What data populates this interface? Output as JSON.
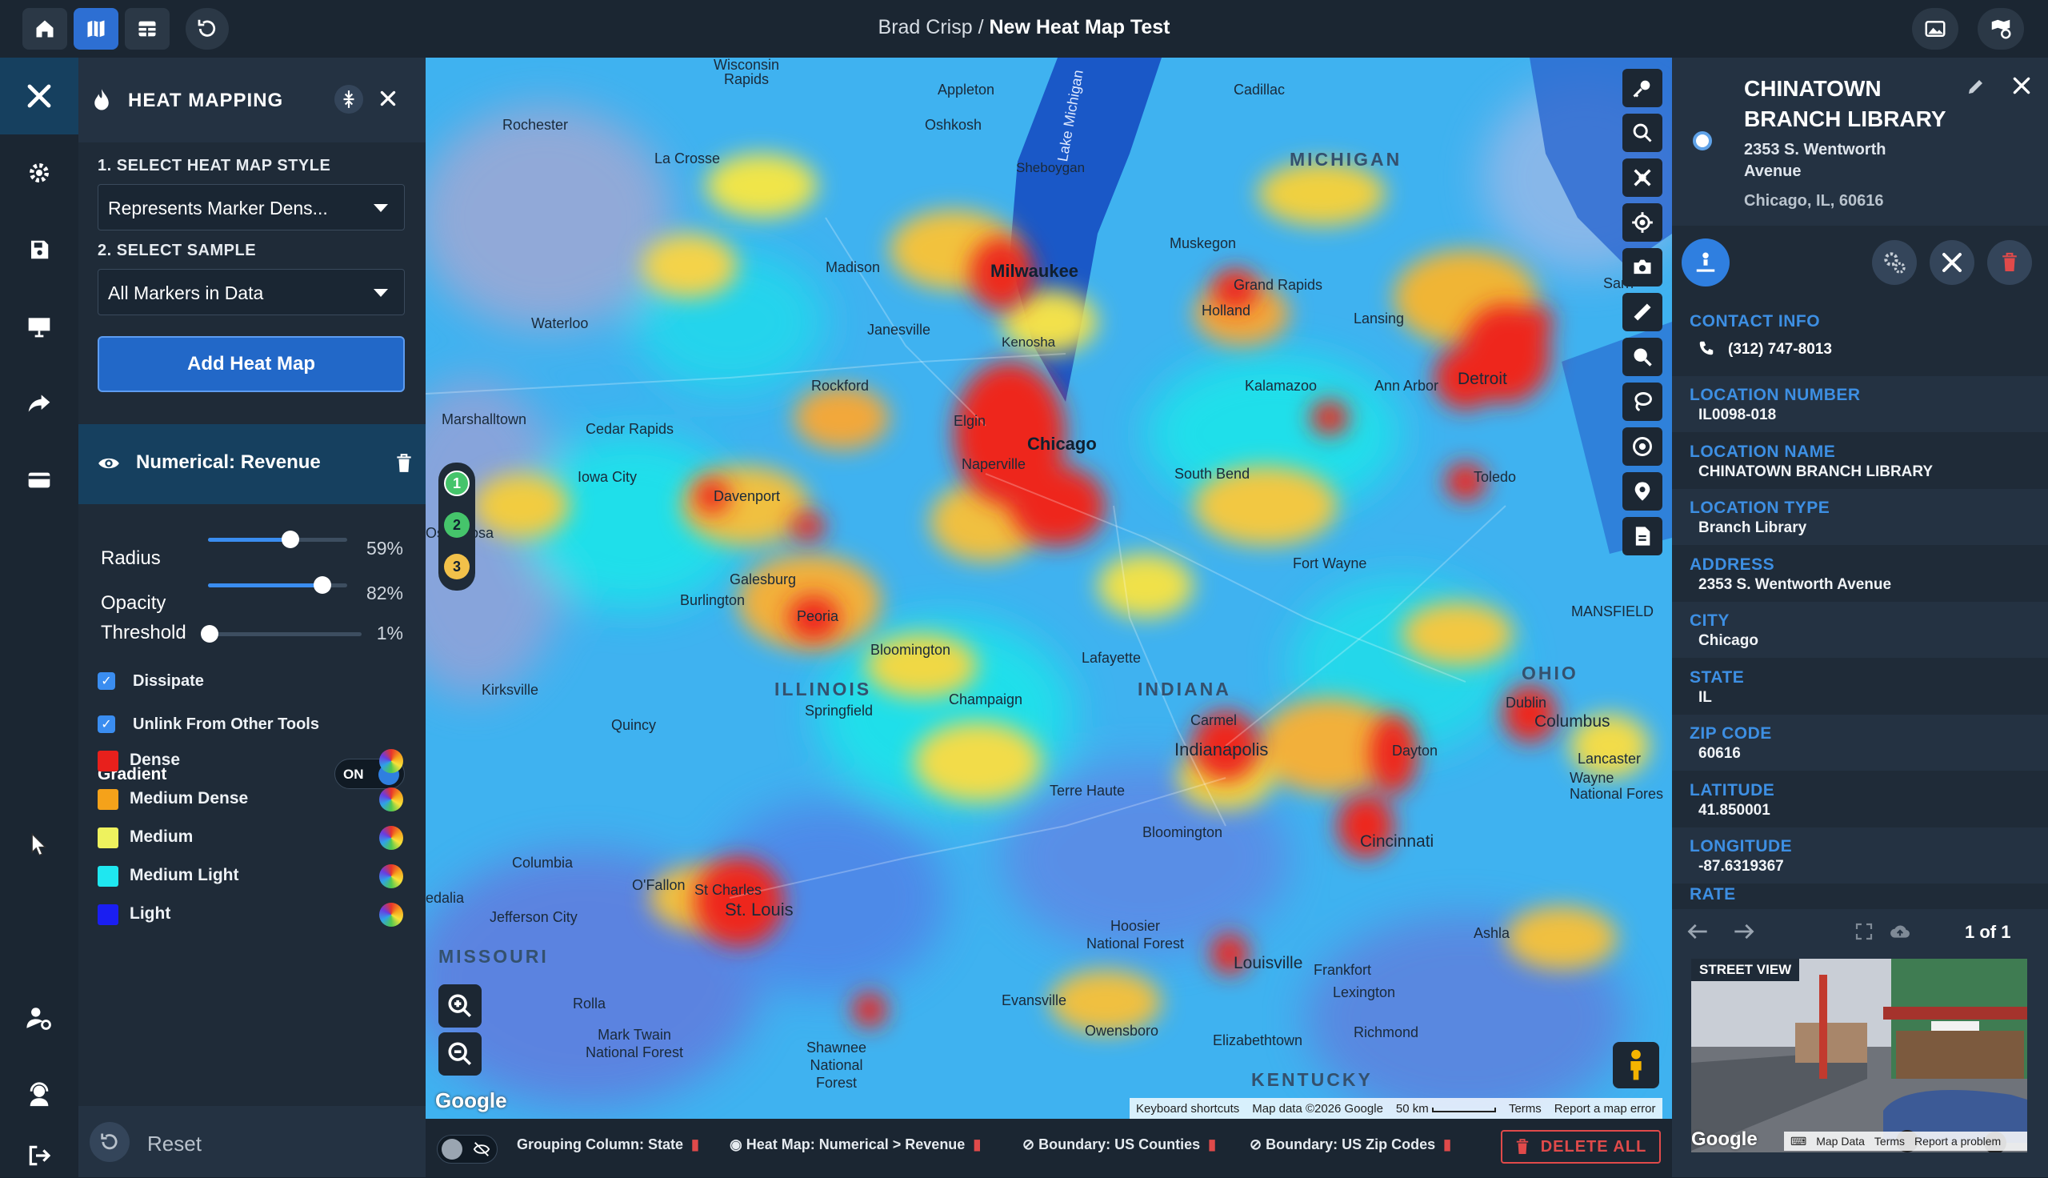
{
  "header": {
    "breadcrumb_user": "Brad Crisp",
    "breadcrumb_sep": "/",
    "breadcrumb_map": "New Heat Map Test"
  },
  "panel": {
    "title": "HEAT MAPPING",
    "step1_label": "1. SELECT HEAT MAP STYLE",
    "step1_value": "Represents Marker Dens...",
    "step2_label": "2. SELECT SAMPLE",
    "step2_value": "All Markers in Data",
    "add_button": "Add Heat Map",
    "layer_name": "Numerical: Revenue",
    "sliders": [
      {
        "label": "Radius",
        "value_text": "59%",
        "value": 0.59
      },
      {
        "label": "Opacity",
        "value_text": "82%",
        "value": 0.82
      },
      {
        "label": "Threshold",
        "value_text": "1%",
        "value": 0.01
      }
    ],
    "checkboxes": [
      {
        "label": "Dissipate",
        "checked": true
      },
      {
        "label": "Unlink From Other Tools",
        "checked": true
      }
    ],
    "gradient_label": "Gradient",
    "gradient_toggle": "ON",
    "gradient": [
      {
        "label": "Dense",
        "color": "#e8201c"
      },
      {
        "label": "Medium Dense",
        "color": "#f5a21a"
      },
      {
        "label": "Medium",
        "color": "#eef25e"
      },
      {
        "label": "Medium Light",
        "color": "#1fe7f0"
      },
      {
        "label": "Light",
        "color": "#1a1ef2"
      }
    ],
    "reset_label": "Reset"
  },
  "map": {
    "labels": {
      "wisconsin_rapids": "Wisconsin\nRapids",
      "appleton": "Appleton",
      "oshkosh": "Oshkosh",
      "rochester": "Rochester",
      "la_crosse": "La Crosse",
      "sheboygan": "Sheboygan",
      "cadillac": "Cadillac",
      "michigan": "MICHIGAN",
      "madison": "Madison",
      "milwaukee": "Milwaukee",
      "muskegon": "Muskegon",
      "grand_rapids": "Grand Rapids",
      "holland": "Holland",
      "lansing": "Lansing",
      "waterloo": "Waterloo",
      "janesville": "Janesville",
      "kenosha": "Kenosha",
      "rockford": "Rockford",
      "kalamazoo": "Kalamazoo",
      "ann_arbor": "Ann Arbor",
      "detroit": "Detroit",
      "marshalltown": "Marshalltown",
      "cedar_rapids": "Cedar Rapids",
      "iowa_city": "Iowa City",
      "elgin": "Elgin",
      "chicago": "Chicago",
      "naperville": "Naperville",
      "south_bend": "South Bend",
      "toledo": "Toledo",
      "davenport": "Davenport",
      "oskaloosa": "Oskaloosa",
      "burlington": "Burlington",
      "galesburg": "Galesburg",
      "peoria": "Peoria",
      "bloomington": "Bloomington",
      "fort_wayne": "Fort Wayne",
      "mansfield": "MANSFIELD",
      "lafayette": "Lafayette",
      "kirksville": "Kirksville",
      "illinois": "ILLINOIS",
      "indiana": "INDIANA",
      "ohio": "OHIO",
      "dublin": "Dublin",
      "quincy": "Quincy",
      "champaign": "Champaign",
      "springfield": "Springfield",
      "carmel": "Carmel",
      "indianapolis": "Indianapolis",
      "columbus": "Columbus",
      "dayton": "Dayton",
      "lancaster": "Lancaster",
      "terre_haute": "Terre Haute",
      "wayne_nf": "Wayne\nNational Fores",
      "columbia": "Columbia",
      "bloomington_in": "Bloomington",
      "cincinnati": "Cincinnati",
      "ofallon": "O'Fallon",
      "st_charles": "St Charles",
      "st_louis": "St. Louis",
      "edalia": "edalia",
      "jefferson_city": "Jefferson City",
      "hoosier_nf": "Hoosier\nNational Forest",
      "ashland": "Ashla",
      "missouri": "MISSOURI",
      "frankfort": "Frankfort",
      "louisville": "Louisville",
      "lexington": "Lexington",
      "rolla": "Rolla",
      "mark_twain": "Mark Twain\nNational Forest",
      "shawnee": "Shawnee\nNational\nForest",
      "evansville": "Evansville",
      "owensboro": "Owensboro",
      "elizabethtown": "Elizabethtown",
      "richmond": "Richmond",
      "kentucky": "KENTUCKY",
      "lake_michigan": "Lake Michigan",
      "sarnia": "Sarn"
    },
    "layer_badges": [
      "1",
      "2",
      "3"
    ],
    "google_logo": "Google",
    "attribution": {
      "shortcuts": "Keyboard shortcuts",
      "data": "Map data ©2026 Google",
      "scale": "50 km",
      "terms": "Terms",
      "report": "Report a map error"
    }
  },
  "bottombar": {
    "chips": [
      "Grouping Column: State",
      "Heat Map: Numerical > Revenue",
      "Boundary: US Counties",
      "Boundary: US Zip Codes"
    ],
    "delete_all": "DELETE ALL"
  },
  "detail": {
    "title_line1": "CHINATOWN",
    "title_line2": "BRANCH LIBRARY",
    "address_line1": "2353 S. Wentworth",
    "address_line2": "Avenue",
    "address_line3": "Chicago, IL, 60616",
    "contact_label": "CONTACT INFO",
    "phone": "(312) 747-8013",
    "fields": [
      {
        "label": "LOCATION NUMBER",
        "value": "IL0098-018"
      },
      {
        "label": "LOCATION NAME",
        "value": "CHINATOWN BRANCH LIBRARY"
      },
      {
        "label": "LOCATION TYPE",
        "value": "Branch Library"
      },
      {
        "label": "ADDRESS",
        "value": "2353 S. Wentworth Avenue"
      },
      {
        "label": "CITY",
        "value": "Chicago"
      },
      {
        "label": "STATE",
        "value": "IL"
      },
      {
        "label": "ZIP CODE",
        "value": "60616"
      },
      {
        "label": "LATITUDE",
        "value": "41.850001"
      },
      {
        "label": "LONGITUDE",
        "value": "-87.6319367"
      }
    ],
    "rate_label": "RATE",
    "pager": "1 of 1",
    "street_view_label": "STREET VIEW",
    "sv_google": "Google",
    "sv_map_data": "Map Data",
    "sv_terms": "Terms",
    "sv_report": "Report a problem"
  },
  "colors": {
    "accent": "#2268c8",
    "danger": "#e04a4a",
    "field_label": "#3d8fe3"
  }
}
